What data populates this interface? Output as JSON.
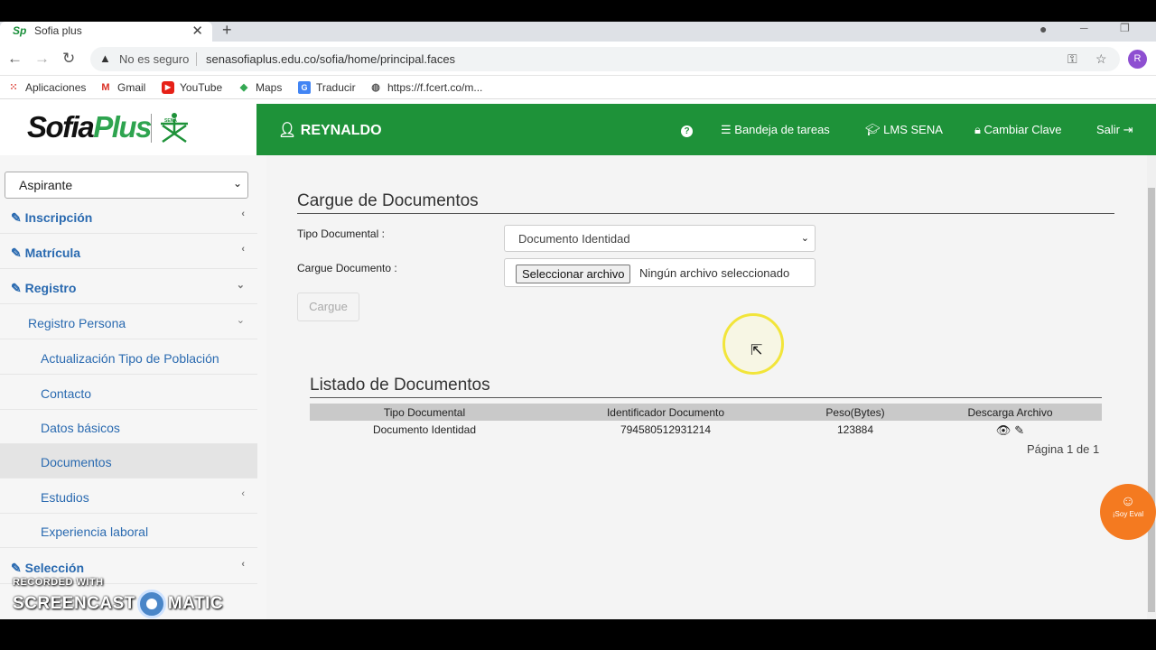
{
  "browser": {
    "tab_title": "Sofia plus",
    "tab_favicon": "Sp",
    "not_secure": "No es seguro",
    "url": "senasofiaplus.edu.co/sofia/home/principal.faces",
    "profile_initial": "R",
    "bookmarks": [
      {
        "label": "Aplicaciones",
        "icon": "apps-grid-icon"
      },
      {
        "label": "Gmail",
        "icon": "gmail-icon"
      },
      {
        "label": "YouTube",
        "icon": "youtube-icon"
      },
      {
        "label": "Maps",
        "icon": "maps-icon"
      },
      {
        "label": "Traducir",
        "icon": "translate-icon"
      },
      {
        "label": "https://f.fcert.co/m...",
        "icon": "globe-icon"
      }
    ]
  },
  "header": {
    "logo_sofia": "Sofia",
    "logo_plus": "Plus",
    "logo_sena": "SENA",
    "user_name": "REYNALDO",
    "help_icon": "question-circle-icon",
    "links": {
      "tasks": "Bandeja de tareas",
      "lms": "LMS SENA",
      "password": "Cambiar Clave",
      "logout": "Salir"
    },
    "accent_color": "#1e9239"
  },
  "sidebar": {
    "role": "Aspirante",
    "items": [
      {
        "label": "Inscripción"
      },
      {
        "label": "Matrícula"
      },
      {
        "label": "Registro"
      },
      {
        "label": "Registro Persona"
      },
      {
        "label": "Actualización Tipo de Población"
      },
      {
        "label": "Contacto"
      },
      {
        "label": "Datos básicos"
      },
      {
        "label": "Documentos"
      },
      {
        "label": "Estudios"
      },
      {
        "label": "Experiencia laboral"
      },
      {
        "label": "Selección"
      }
    ]
  },
  "main": {
    "upload_title": "Cargue de Documentos",
    "tipo_label": "Tipo Documental :",
    "tipo_value": "Documento Identidad",
    "cargue_label": "Cargue Documento :",
    "file_button": "Seleccionar archivo",
    "file_status": "Ningún archivo seleccionado",
    "submit_label": "Cargue",
    "list_title": "Listado de Documentos",
    "columns": [
      "Tipo Documental",
      "Identificador Documento",
      "Peso(Bytes)",
      "Descarga Archivo"
    ],
    "rows": [
      {
        "tipo": "Documento Identidad",
        "id": "794580512931214",
        "peso": "123884"
      }
    ],
    "pager": "Página 1 de 1"
  },
  "eval_badge": "¡Soy Eval",
  "watermark": {
    "line1": "RECORDED WITH",
    "brand_left": "SCREENCAST",
    "brand_right": "MATIC"
  }
}
